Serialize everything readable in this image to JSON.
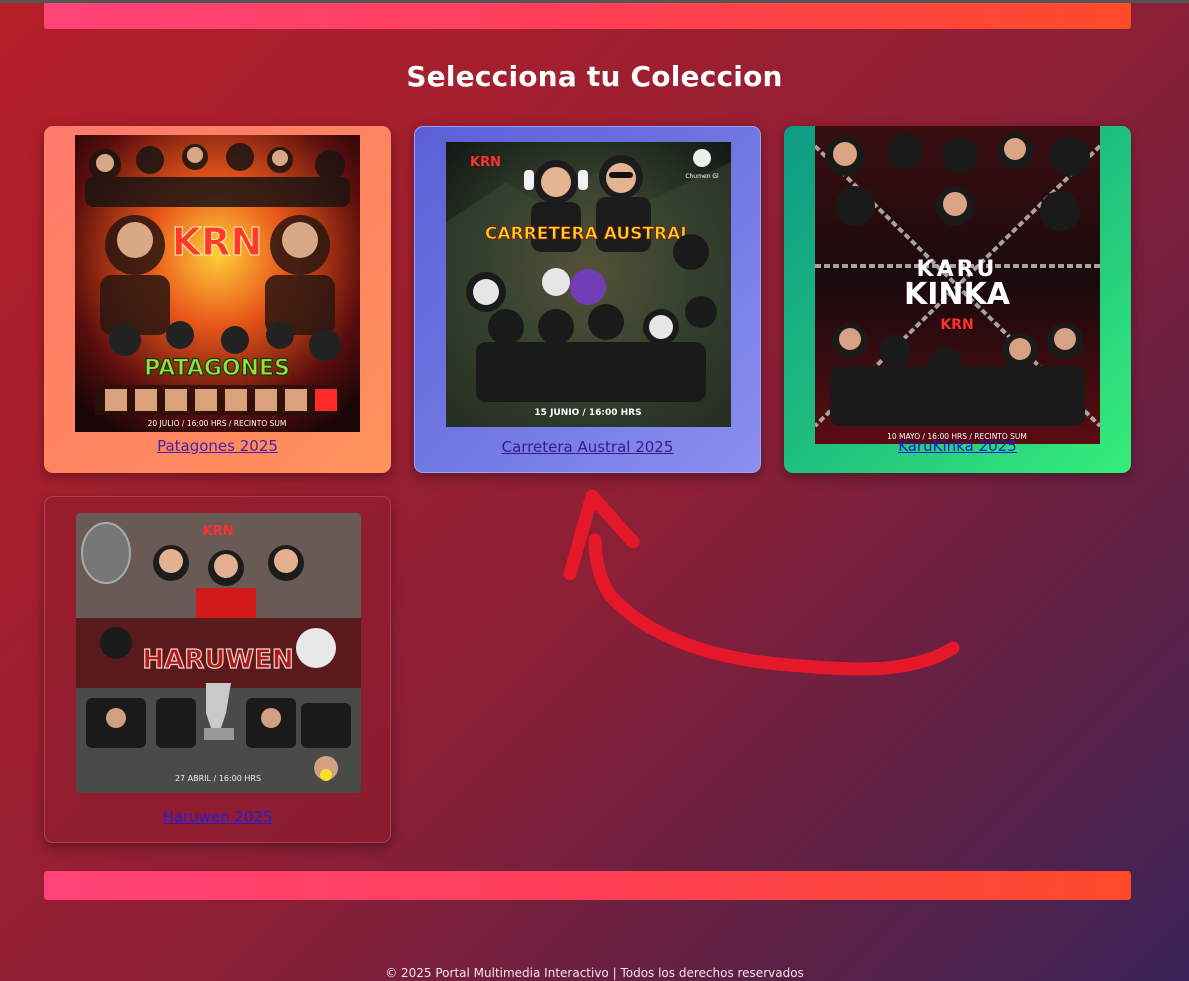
{
  "page": {
    "title": "Selecciona tu Coleccion",
    "footer": "© 2025 Portal Multimedia Interactivo | Todos los derechos reservados"
  },
  "colors": {
    "accent_bar_start": "#ff4378",
    "accent_bar_end": "#ff4a2a",
    "arrow": "#e5182a"
  },
  "collections": [
    {
      "name": "Patagones 2025",
      "poster": {
        "logo": "KRN",
        "title": "PATAGONES",
        "caption": "20 JULIO / 16:00 HRS / RECINTO SUM"
      }
    },
    {
      "name": "Carretera Austral 2025",
      "poster": {
        "logo": "KRN",
        "title": "CARRETERA AUSTRAL",
        "badge": "Chumen Gl",
        "caption": "15 JUNIO / 16:00 HRS"
      }
    },
    {
      "name": "KaruKinka 2025",
      "poster": {
        "logo": "KRN",
        "title_line1": "KARU",
        "title_line2": "KINKA",
        "caption": "10 MAYO / 16:00 HRS / RECINTO SUM"
      }
    },
    {
      "name": "Haruwen 2025",
      "poster": {
        "logo": "KRN",
        "title": "HARUWEN",
        "caption": "27 ABRIL / 16:00 HRS"
      }
    }
  ]
}
